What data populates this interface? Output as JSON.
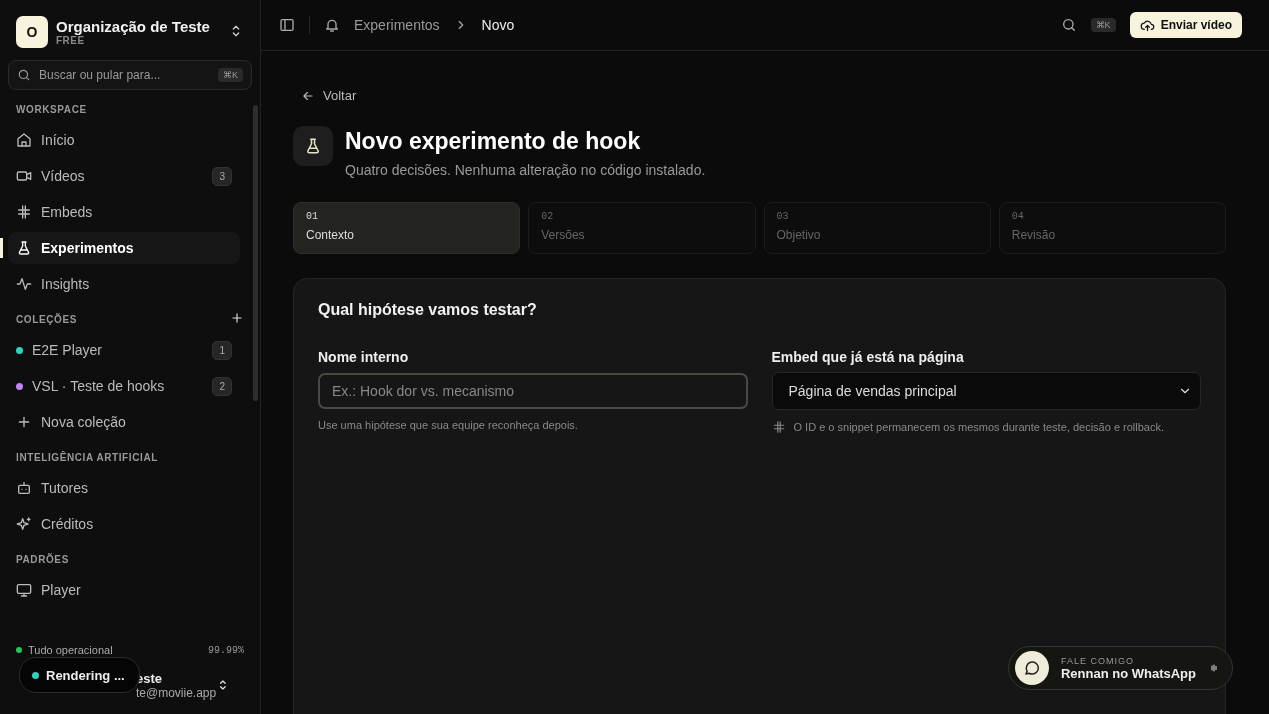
{
  "org": {
    "initial": "O",
    "name": "Organização de Teste",
    "plan": "FREE"
  },
  "search": {
    "placeholder": "Buscar ou pular para...",
    "shortcut": "⌘K"
  },
  "sections": [
    {
      "title": "WORKSPACE",
      "items": [
        {
          "kind": "nav",
          "label": "Início",
          "selected": false
        },
        {
          "kind": "nav",
          "label": "Vídeos",
          "badge": "3",
          "selected": false
        },
        {
          "kind": "nav",
          "label": "Embeds",
          "selected": false
        },
        {
          "kind": "nav",
          "label": "Experimentos",
          "selected": true
        },
        {
          "kind": "nav",
          "label": "Insights",
          "selected": false
        }
      ]
    },
    {
      "title": "COLEÇÕES",
      "items": [
        {
          "kind": "collection",
          "label": "E2E Player",
          "badge": "1",
          "color": "#2dd4bf",
          "selected": false
        },
        {
          "kind": "collection",
          "label": "VSL · Teste de hooks",
          "badge": "2",
          "color": "#c084fc",
          "selected": false
        },
        {
          "kind": "new",
          "label": "Nova coleção",
          "selected": false
        }
      ]
    },
    {
      "title": "INTELIGÊNCIA ARTIFICIAL",
      "items": [
        {
          "kind": "nav",
          "label": "Tutores",
          "selected": false
        },
        {
          "kind": "nav",
          "label": "Créditos",
          "selected": false
        }
      ]
    },
    {
      "title": "PADRÕES",
      "items": [
        {
          "kind": "nav",
          "label": "Player",
          "selected": false
        }
      ]
    }
  ],
  "status": {
    "label": "Tudo operacional",
    "uptime": "99.99%"
  },
  "user": {
    "name": "este",
    "email": "te@moviie.app"
  },
  "rendering": {
    "label": "Rendering ..."
  },
  "breadcrumb": [
    {
      "label": "Experimentos",
      "selected": false
    },
    {
      "label": "Novo",
      "selected": true
    }
  ],
  "topbar": {
    "shortcut": "⌘K",
    "upload": "Enviar vídeo"
  },
  "back": "Voltar",
  "header": {
    "title": "Novo experimento de hook",
    "subtitle": "Quatro decisões. Nenhuma alteração no código instalado."
  },
  "steps": [
    {
      "number": "01",
      "label": "Contexto",
      "selected": true
    },
    {
      "number": "02",
      "label": "Versões",
      "selected": false
    },
    {
      "number": "03",
      "label": "Objetivo",
      "selected": false
    },
    {
      "number": "04",
      "label": "Revisão",
      "selected": false
    }
  ],
  "form": {
    "title": "Qual hipótese vamos testar?",
    "name_field": {
      "label": "Nome interno",
      "placeholder": "Ex.: Hook dor vs. mecanismo",
      "hint": "Use uma hipótese que sua equipe reconheça depois."
    },
    "embed_field": {
      "label": "Embed que já está na página",
      "value": "Página de vendas principal",
      "hint": "O ID e o snippet permanecem os mesmos durante teste, decisão e rollback."
    }
  },
  "whatsapp": {
    "caption": "FALE COMIGO",
    "label": "Rennan no WhatsApp"
  }
}
